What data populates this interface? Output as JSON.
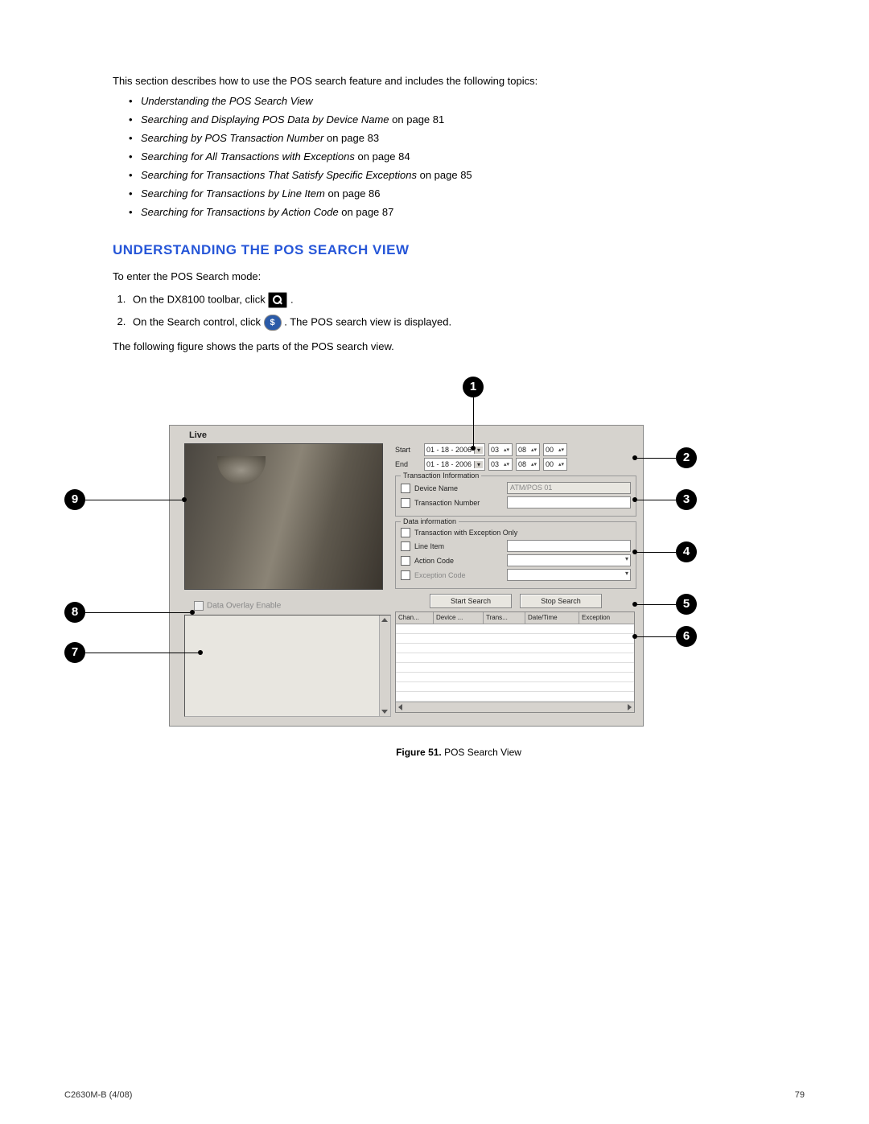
{
  "intro": "This section describes how to use the POS search feature and includes the following topics:",
  "topics": [
    {
      "italic": "Understanding the POS Search View",
      "rest": ""
    },
    {
      "italic": "Searching and Displaying POS Data by Device Name",
      "rest": " on page 81"
    },
    {
      "italic": "Searching by POS Transaction Number",
      "rest": " on page 83"
    },
    {
      "italic": "Searching for All Transactions with Exceptions",
      "rest": " on page 84"
    },
    {
      "italic": "Searching for Transactions That Satisfy Specific Exceptions",
      "rest": " on page 85"
    },
    {
      "italic": "Searching for Transactions by Line Item",
      "rest": " on page 86"
    },
    {
      "italic": "Searching for Transactions by Action Code",
      "rest": " on page 87"
    }
  ],
  "heading": "UNDERSTANDING THE POS SEARCH VIEW",
  "enterLine": "To enter the POS Search mode:",
  "step1_a": "On the DX8100 toolbar, click ",
  "step1_b": " .",
  "step2_a": "On the Search control, click ",
  "step2_b": " . The POS search view is displayed.",
  "followPara": "The following figure shows the parts of the POS search view.",
  "app": {
    "liveLabel": "Live",
    "overlayLabel": "Data Overlay Enable",
    "date": {
      "startLabel": "Start",
      "endLabel": "End",
      "startDate": "01 - 18 - 2006",
      "endDate": "01 - 18 - 2006",
      "h": "03",
      "m": "08",
      "s": "00"
    },
    "transBox": {
      "title": "Transaction Information",
      "deviceName": "Device Name",
      "deviceValue": "ATM/POS 01",
      "transNum": "Transaction Number"
    },
    "dataBox": {
      "title": "Data information",
      "excOnly": "Transaction with Exception Only",
      "lineItem": "Line Item",
      "actionCode": "Action Code",
      "excCode": "Exception Code"
    },
    "buttons": {
      "start": "Start Search",
      "stop": "Stop Search"
    },
    "cols": {
      "c1": "Chan...",
      "c2": "Device ...",
      "c3": "Trans...",
      "c4": "Date/Time",
      "c5": "Exception"
    }
  },
  "captionBold": "Figure 51.",
  "captionRest": "  POS Search View",
  "footerLeft": "C2630M-B (4/08)",
  "footerRight": "79"
}
